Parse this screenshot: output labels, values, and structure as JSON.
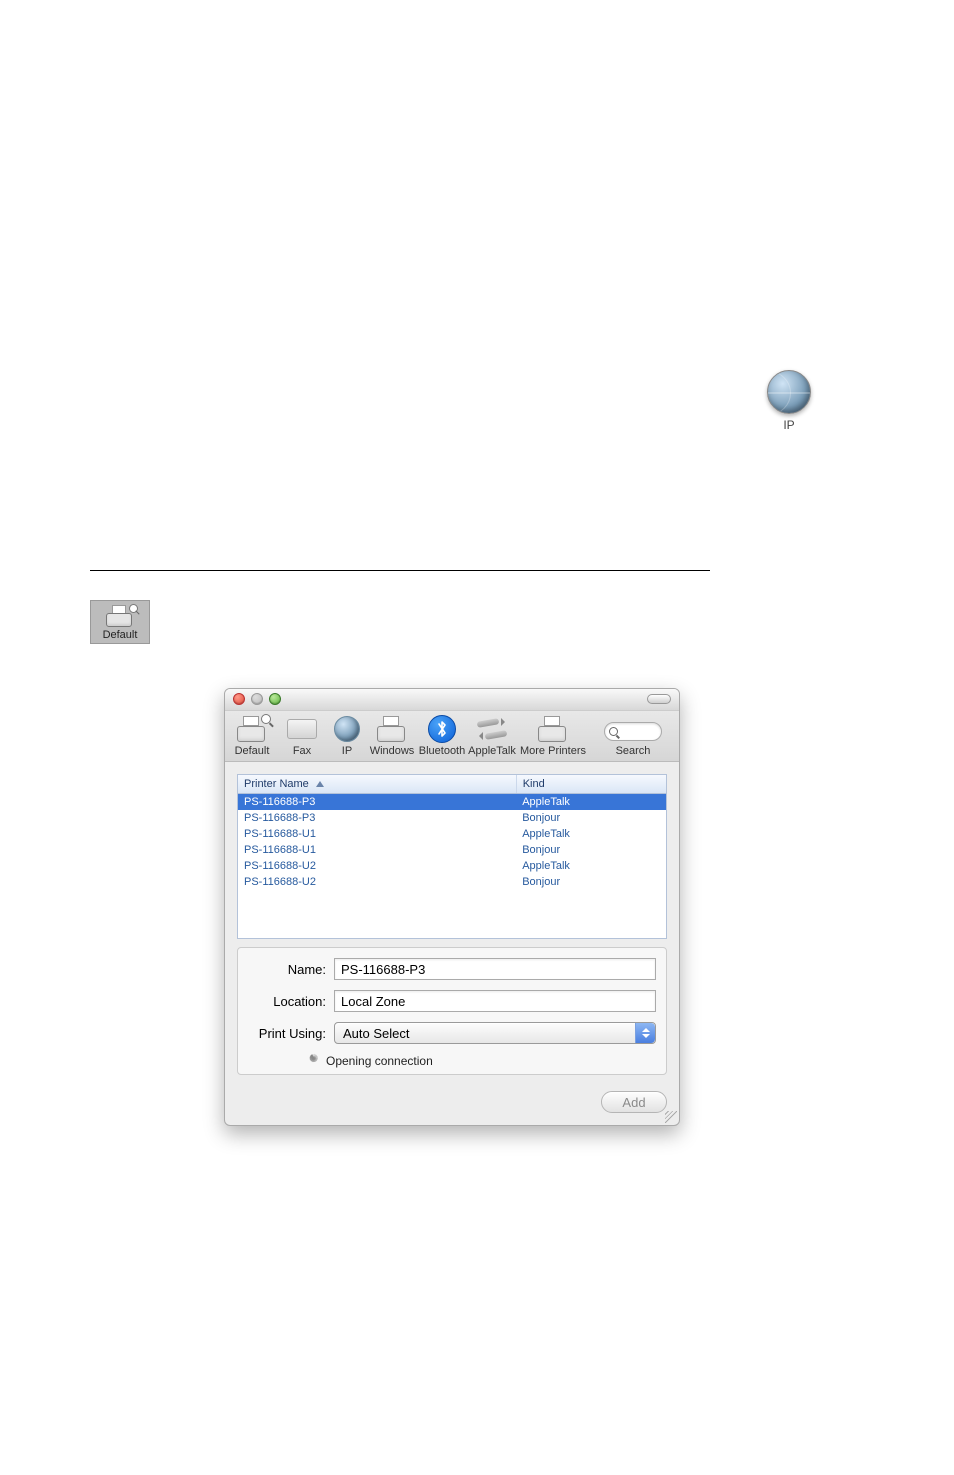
{
  "ip_icon_label": "IP",
  "default_icon_label": "Default",
  "dialog": {
    "toolbar": [
      {
        "key": "default",
        "label": "Default"
      },
      {
        "key": "fax",
        "label": "Fax"
      },
      {
        "key": "ip",
        "label": "IP"
      },
      {
        "key": "windows",
        "label": "Windows"
      },
      {
        "key": "bluetooth",
        "label": "Bluetooth"
      },
      {
        "key": "appletalk",
        "label": "AppleTalk"
      },
      {
        "key": "more",
        "label": "More Printers"
      }
    ],
    "search_label": "Search",
    "columns": {
      "name": "Printer Name",
      "kind": "Kind"
    },
    "rows": [
      {
        "name": "PS-116688-P3",
        "kind": "AppleTalk",
        "selected": true
      },
      {
        "name": "PS-116688-P3",
        "kind": "Bonjour"
      },
      {
        "name": "PS-116688-U1",
        "kind": "AppleTalk"
      },
      {
        "name": "PS-116688-U1",
        "kind": "Bonjour"
      },
      {
        "name": "PS-116688-U2",
        "kind": "AppleTalk"
      },
      {
        "name": "PS-116688-U2",
        "kind": "Bonjour"
      }
    ],
    "form": {
      "name_label": "Name:",
      "name_value": "PS-116688-P3",
      "location_label": "Location:",
      "location_value": "Local Zone",
      "print_using_label": "Print Using:",
      "print_using_value": "Auto Select",
      "status_text": "Opening connection"
    },
    "add_button": "Add"
  }
}
